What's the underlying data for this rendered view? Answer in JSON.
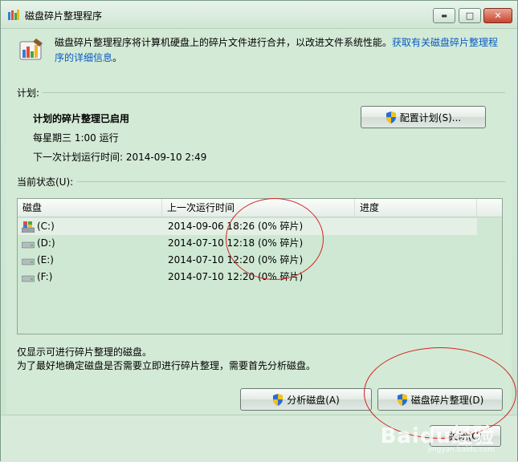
{
  "window": {
    "title": "磁盘碎片整理程序",
    "minimize_glyph": "▬",
    "maximize_glyph": "□",
    "close_glyph": "✕",
    "icon": "defrag-app-icon"
  },
  "intro": {
    "text": "磁盘碎片整理程序将计算机硬盘上的碎片文件进行合并，以改进文件系统性能。",
    "link_line1": "获取有关磁盘碎片整理程",
    "link_line2": "序的详细信息",
    "link_suffix": "。"
  },
  "schedule": {
    "group_label": "计划:",
    "status": "计划的碎片整理已启用",
    "frequency": "每星期三  1:00 运行",
    "next_run": "下一次计划运行时间: 2014-09-10 2:49",
    "configure_button": "配置计划(S)..."
  },
  "current_status": {
    "group_label": "当前状态(U):",
    "columns": [
      "磁盘",
      "上一次运行时间",
      "进度"
    ],
    "rows": [
      {
        "disk": "(C:)",
        "last_run": "2014-09-06 18:26 (0% 碎片)",
        "progress": "",
        "icon": "system-drive-icon"
      },
      {
        "disk": "(D:)",
        "last_run": "2014-07-10 12:18 (0% 碎片)",
        "progress": "",
        "icon": "hard-drive-icon"
      },
      {
        "disk": "(E:)",
        "last_run": "2014-07-10 12:20 (0% 碎片)",
        "progress": "",
        "icon": "hard-drive-icon"
      },
      {
        "disk": "(F:)",
        "last_run": "2014-07-10 12:20 (0% 碎片)",
        "progress": "",
        "icon": "hard-drive-icon"
      }
    ]
  },
  "notes": {
    "line1": "仅显示可进行碎片整理的磁盘。",
    "line2": "为了最好地确定磁盘是否需要立即进行碎片整理，需要首先分析磁盘。"
  },
  "actions": {
    "analyze_button": "分析磁盘(A)",
    "defrag_button": "磁盘碎片整理(D)",
    "close_button": "关闭(C)"
  },
  "watermark": {
    "brand": "Baidu经验",
    "url": "jingyan.baidu.com"
  },
  "colors": {
    "window_bg": "#d3ead6",
    "link": "#0a5bc4",
    "annotation_circle": "#d42626"
  }
}
